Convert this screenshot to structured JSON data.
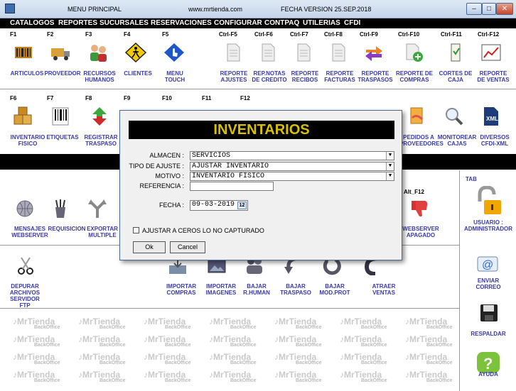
{
  "titlebar": {
    "menu": "MENU PRINCIPAL",
    "site": "www.mrtienda.com",
    "version": "FECHA VERSION 25.SEP.2018",
    "min": "–",
    "max": "□",
    "close": "✕"
  },
  "menu": [
    "CATALOGOS",
    "REPORTES",
    "SUCURSALES",
    "RESERVACIONES",
    "CONFIGURAR",
    "CONTPAQ",
    "UTILERIAS",
    "CFDI"
  ],
  "row1_keys": [
    "F1",
    "F2",
    "F3",
    "F4",
    "F5",
    "Ctrl-F5",
    "Ctrl-F6",
    "Ctrl-F7",
    "Ctrl-F8",
    "Ctrl-F9",
    "Ctrl-F10",
    "Ctrl-F11",
    "Ctrl-F12"
  ],
  "row1": [
    "ARTICULOS",
    "PROVEEDOR",
    "RECURSOS\nHUMANOS",
    "CLIENTES",
    "MENU\nTOUCH",
    "REPORTE\nAJUSTES",
    "REP.NOTAS\nDE CREDITO",
    "REPORTE\nRECIBOS",
    "REPORTE\nFACTURAS",
    "REPORTE\nTRASPASOS",
    "REPORTE DE\nCOMPRAS",
    "CORTES DE\nCAJA",
    "REPORTE\nDE VENTAS"
  ],
  "row2_keys": [
    "F6",
    "F7",
    "F8",
    "F9",
    "F10",
    "F11",
    "F12"
  ],
  "row2": [
    "INVENTARIO\nFISICO",
    "ETIQUETAS",
    "REGISTRAR\nTRASPASO",
    "PEDIDOS A\nPROVEEDORES",
    "MONITOREAR\nCAJAS",
    "DIVERSOS\nCFDI-XML"
  ],
  "alt_key": "Alt_F12",
  "row3": [
    "MENSAJES\nWEBSERVER",
    "REQUISICION",
    "EXPORTAR\nMULTIPLE",
    "WEBSERVER\nAPAGADO"
  ],
  "row4": [
    "DEPURAR\nARCHIVOS\nSERVIDOR FTP",
    "IMPORTAR\nCOMPRAS",
    "IMPORTAR\nIMAGENES",
    "BAJAR\nR.HUMAN",
    "BAJAR\nTRASPASO",
    "BAJAR\nMOD.PROT",
    "ATRAER\nVENTAS"
  ],
  "right": {
    "tab": "TAB",
    "usuario": "USUARIO :\nADMINISTRADOR",
    "correo": "ENVIAR\nCORREO",
    "respaldar": "RESPALDAR",
    "ayuda": "AYUDA"
  },
  "watermark": {
    "brand": "MrTienda",
    "sub": "BackOffice"
  },
  "dialog": {
    "title": "INVENTARIOS",
    "almacen_label": "ALMACEN :",
    "almacen": "SERVICIOS",
    "tipo_label": "TIPO DE AJUSTE :",
    "tipo": "AJUSTAR INVENTARIO",
    "motivo_label": "MOTIVO :",
    "motivo": "INVENTARIO FISICO",
    "ref_label": "REFERENCIA :",
    "ref": "",
    "fecha_label": "FECHA :",
    "fecha": "09-03-2019",
    "cal_day": "12",
    "ceros": "AJUSTAR A CEROS LO NO CAPTURADO",
    "ok": "Ok",
    "cancel": "Cancel"
  },
  "colors": {
    "label_blue": "#3a3aa8",
    "title_yellow": "#d8c000",
    "menubar": "#000000"
  }
}
